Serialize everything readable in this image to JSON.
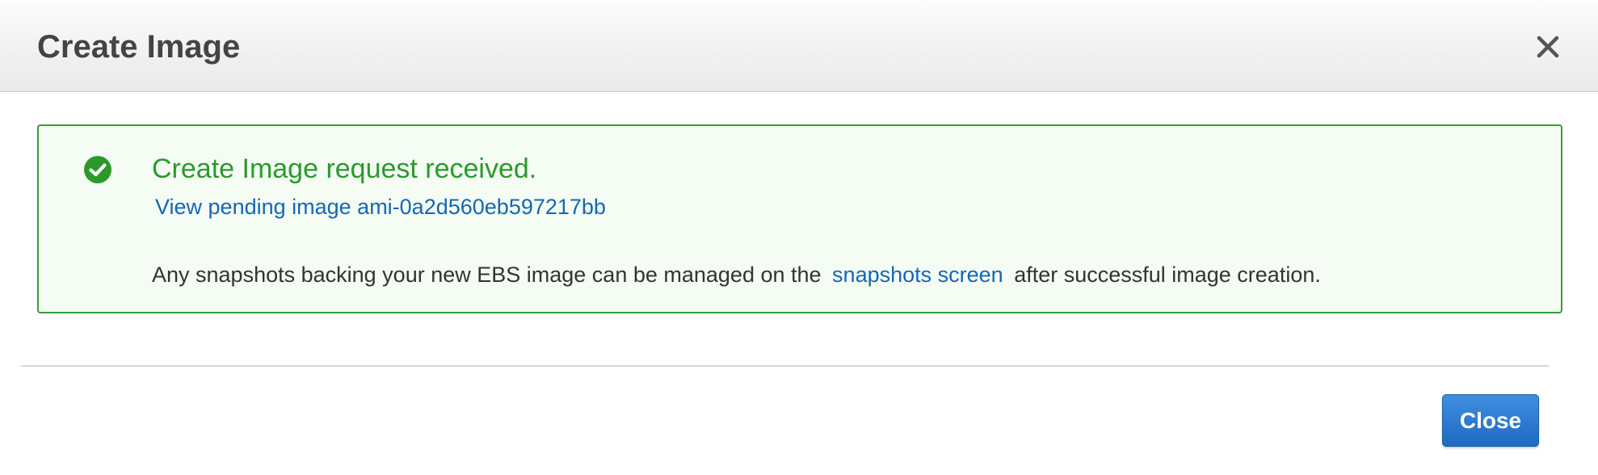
{
  "dialog": {
    "title": "Create Image",
    "close_icon": "close-x-icon"
  },
  "alert": {
    "status": "success",
    "icon": "check-circle-icon",
    "title": "Create Image request received.",
    "pending_link": "View pending image ami-0a2d560eb597217bb",
    "note_prefix": "Any snapshots backing your new EBS image can be managed on the",
    "note_link": "snapshots screen",
    "note_suffix": "after successful image creation."
  },
  "footer": {
    "close_label": "Close"
  },
  "colors": {
    "success_green": "#2b9a2b",
    "success_border": "#3a9d3a",
    "success_background": "#f4fcf4",
    "link_blue": "#1567b5",
    "primary_button": "#2a7bd1"
  }
}
